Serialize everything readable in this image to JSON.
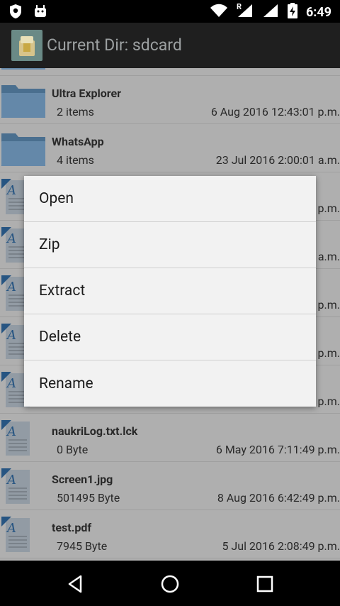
{
  "status_bar": {
    "time": "6:49",
    "icons": [
      "shield-icon",
      "android-icon",
      "wifi-icon",
      "signal-icon",
      "battery-charging-icon"
    ],
    "roaming_label": "R"
  },
  "app_bar": {
    "title": "Current Dir: sdcard",
    "icon": "folder-app-icon"
  },
  "files": [
    {
      "name": "Ultra Explorer",
      "size": "2 items",
      "date": "6 Aug 2016 12:43:01 p.m.",
      "type": "folder"
    },
    {
      "name": "WhatsApp",
      "size": "4 items",
      "date": "23 Jul 2016 2:00:01 a.m.",
      "type": "folder"
    },
    {
      "name": "",
      "size": "",
      "date": "p.m.",
      "type": "file"
    },
    {
      "name": "",
      "size": "",
      "date": "a.m.",
      "type": "file"
    },
    {
      "name": "",
      "size": "",
      "date": "p.m.",
      "type": "file"
    },
    {
      "name": "",
      "size": "",
      "date": "p.m.",
      "type": "file"
    },
    {
      "name": "",
      "size": "",
      "date": "p.m.",
      "type": "file"
    },
    {
      "name": "naukriLog.txt.lck",
      "size": "0 Byte",
      "date": "6 May 2016 7:11:49 p.m.",
      "type": "file"
    },
    {
      "name": "Screen1.jpg",
      "size": "501495 Byte",
      "date": "8 Aug 2016 6:42:49 p.m.",
      "type": "file"
    },
    {
      "name": "test.pdf",
      "size": "7945 Byte",
      "date": "5 Jul 2016 2:08:49 p.m.",
      "type": "file"
    }
  ],
  "context_menu": {
    "items": [
      "Open",
      "Zip",
      "Extract",
      "Delete",
      "Rename"
    ]
  },
  "nav_bar": {
    "icons": [
      "back-icon",
      "home-icon",
      "recents-icon"
    ]
  }
}
